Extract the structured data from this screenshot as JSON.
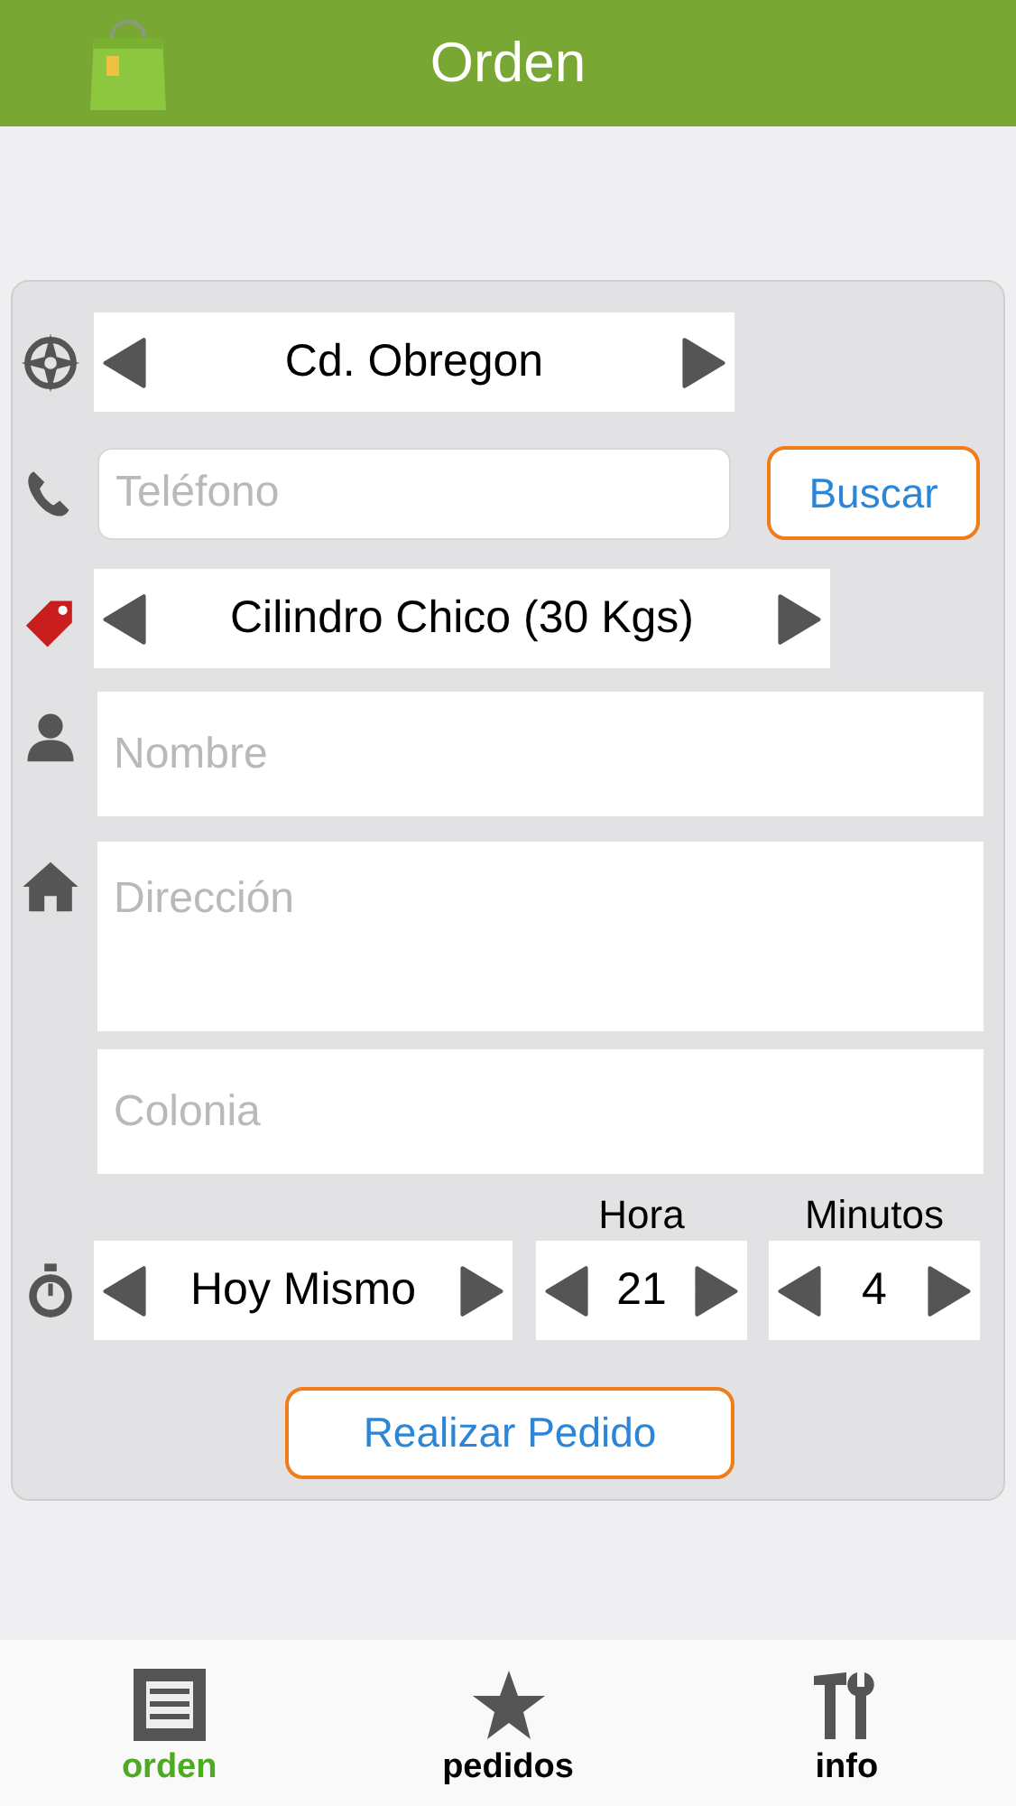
{
  "header": {
    "title": "Orden"
  },
  "form": {
    "city_picker": {
      "value": "Cd. Obregon"
    },
    "phone_field": {
      "placeholder": "Teléfono"
    },
    "search_button": "Buscar",
    "product_picker": {
      "value": "Cilindro Chico (30 Kgs)"
    },
    "name_field": {
      "placeholder": "Nombre"
    },
    "address_field": {
      "placeholder": "Dirección"
    },
    "colonia_field": {
      "placeholder": "Colonia"
    },
    "day_picker": {
      "value": "Hoy Mismo"
    },
    "hour_picker": {
      "label": "Hora",
      "value": "21"
    },
    "minute_picker": {
      "label": "Minutos",
      "value": "4"
    },
    "submit_button": "Realizar Pedido"
  },
  "tabs": [
    {
      "kind": "list",
      "label": "orden",
      "selected": true
    },
    {
      "kind": "star",
      "label": "pedidos",
      "selected": false
    },
    {
      "kind": "tools",
      "label": "info",
      "selected": false
    }
  ]
}
